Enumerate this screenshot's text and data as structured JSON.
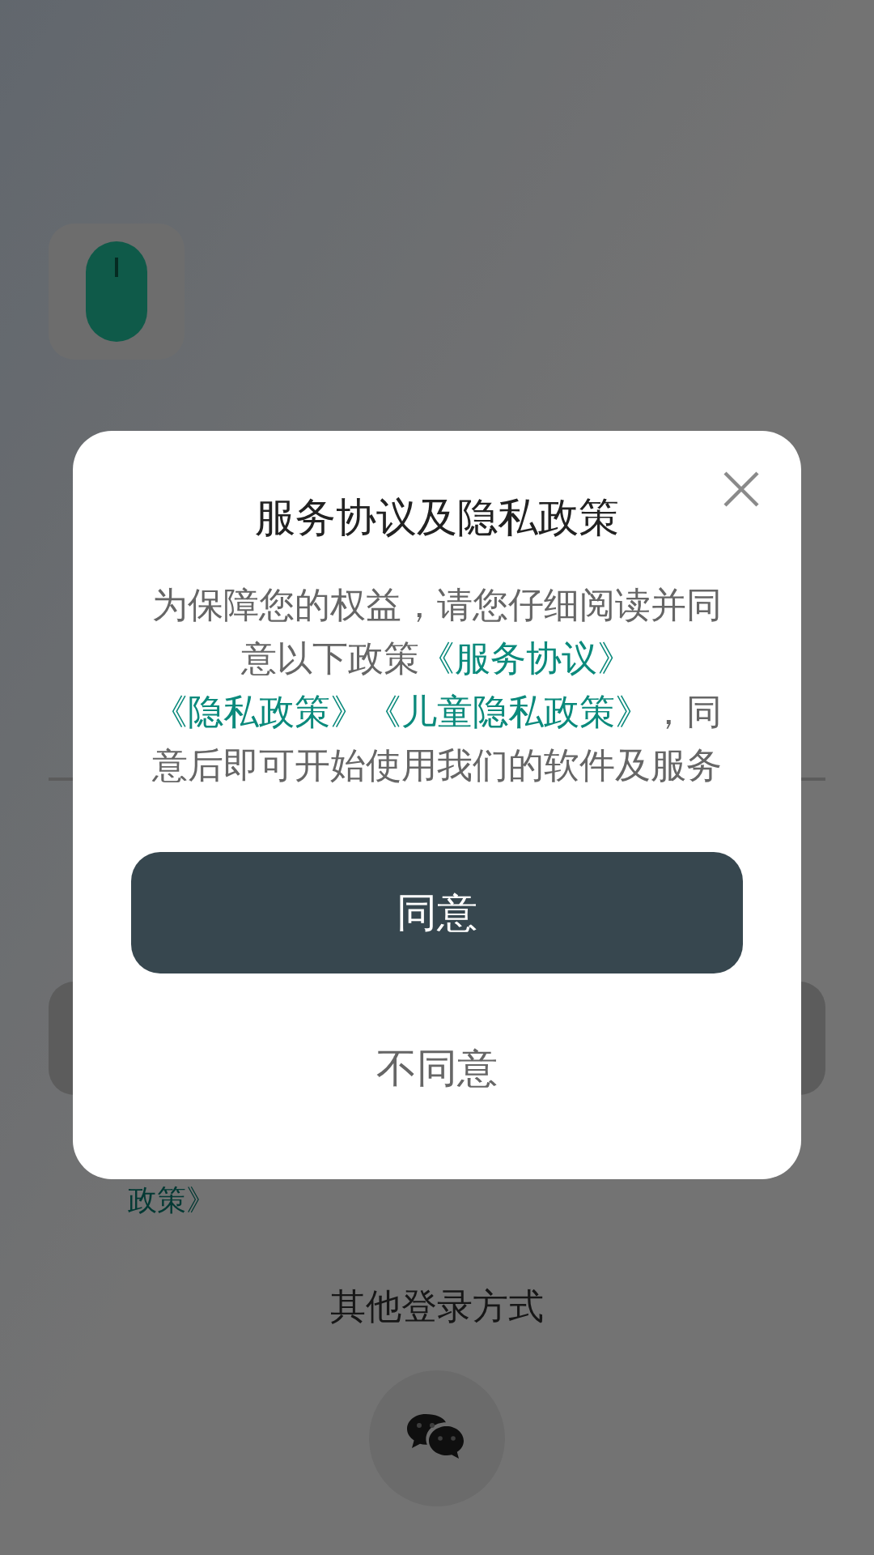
{
  "background": {
    "policy_text": "政策》",
    "other_login": "其他登录方式"
  },
  "dialog": {
    "title": "服务协议及隐私政策",
    "body": [
      {
        "kind": "text",
        "text": "为保障您的权益，请您仔细阅读并同意以下政策"
      },
      {
        "kind": "link",
        "text": "《服务协议》"
      },
      {
        "kind": "link",
        "text": "《隐私政策》"
      },
      {
        "kind": "link",
        "text": "《儿童隐私政策》"
      },
      {
        "kind": "text",
        "text": "，同意后即可开始使用我们的软件及服务"
      }
    ],
    "agree_button": "同意",
    "disagree_button": "不同意"
  }
}
